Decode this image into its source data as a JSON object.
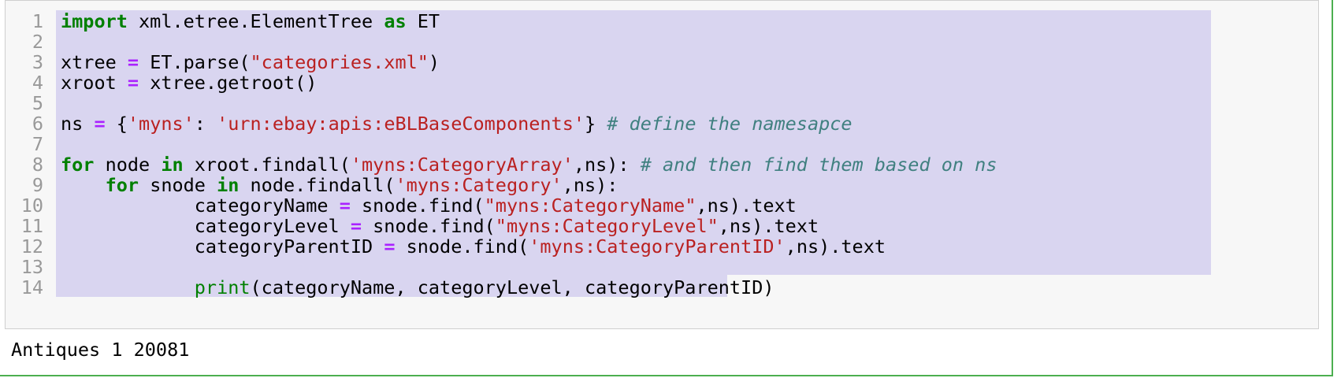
{
  "line_numbers": [
    "1",
    "2",
    "3",
    "4",
    "5",
    "6",
    "7",
    "8",
    "9",
    "10",
    "11",
    "12",
    "13",
    "14"
  ],
  "tokens": {
    "import": "import",
    "mod": " xml.etree.ElementTree ",
    "as": "as",
    "et": " ET",
    "xtree": "xtree ",
    "eq": "=",
    "etparse": " ET.parse(",
    "catxml": "\"categories.xml\"",
    "rparen": ")",
    "xroot": "xroot ",
    "getroot": " xtree.getroot()",
    "ns": "ns ",
    "lbrace": " {",
    "myns_key": "'myns'",
    "colon": ": ",
    "urn": "'urn:ebay:apis:eBLBaseComponents'",
    "rbrace": "} ",
    "comment1": "# define the namesapce",
    "for": "for",
    "node": " node ",
    "in": "in",
    "findall1": " xroot.findall(",
    "catarray": "'myns:CategoryArray'",
    "nsclose": ",ns): ",
    "comment2": "# and then find them based on ns",
    "indent4": "    ",
    "snode": " snode ",
    "findall2": " node.findall(",
    "category": "'myns:Category'",
    "nsclose2": ",ns):",
    "indent12": "            ",
    "catname": "categoryName ",
    "find": " snode.find(",
    "catname_str": "\"myns:CategoryName\"",
    "nstext": ",ns).text",
    "catlevel": "categoryLevel ",
    "catlevel_str": "\"myns:CategoryLevel\"",
    "catparent": "categoryParentID ",
    "catparent_str": "'myns:CategoryParentID'",
    "print": "print",
    "printargs": "(categoryName, categoryLevel, categoryParentID)"
  },
  "output": "Antiques 1 20081"
}
